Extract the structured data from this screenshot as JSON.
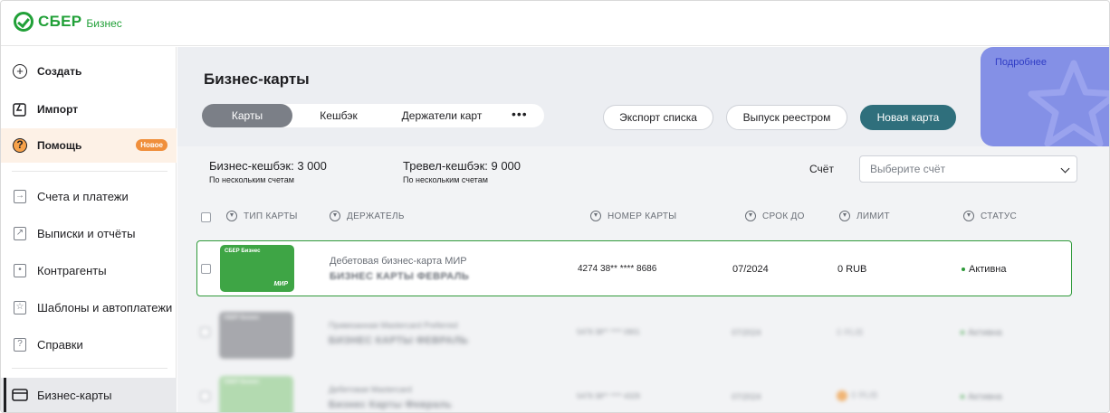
{
  "app": {
    "logo_text": "СБЕР",
    "logo_sub": "Бизнес"
  },
  "sidebar": {
    "create": "Создать",
    "import": "Импорт",
    "help": "Помощь",
    "help_badge": "Новое",
    "items": [
      {
        "label": "Счета и платежи"
      },
      {
        "label": "Выписки и отчёты"
      },
      {
        "label": "Контрагенты"
      },
      {
        "label": "Шаблоны и автоплатежи"
      },
      {
        "label": "Справки"
      }
    ],
    "active": "Бизнес-карты"
  },
  "header": {
    "title": "Бизнес-карты",
    "tabs": [
      "Карты",
      "Кешбэк",
      "Держатели карт"
    ],
    "more": "•••",
    "export_btn": "Экспорт списка",
    "registry_btn": "Выпуск реестром",
    "new_card_btn": "Новая карта",
    "promo_link": "Подробнее"
  },
  "summary": {
    "business_cashback": "Бизнес-кешбэк: 3 000",
    "business_cashback_sub": "По нескольким счетам",
    "travel_cashback": "Тревел-кешбэк: 9 000",
    "travel_cashback_sub": "По нескольким счетам",
    "account_label": "Счёт",
    "account_placeholder": "Выберите счёт"
  },
  "table": {
    "columns": [
      "ТИП КАРТЫ",
      "ДЕРЖАТЕЛЬ",
      "НОМЕР КАРТЫ",
      "СРОК ДО",
      "ЛИМИТ",
      "СТАТУС"
    ],
    "rows": [
      {
        "card_logo": "СБЕР Бизнес",
        "card_brand": "МИР",
        "type": "Дебетовая бизнес-карта МИР",
        "holder": "БИЗНЕС КАРТЫ ФЕВРАЛЬ",
        "number": "4274 38** **** 8686",
        "expiry": "07/2024",
        "limit": "0 RUB",
        "status": "Активна"
      },
      {
        "card_logo": "СБЕР Бизнес",
        "type": "Привязанная Mastercard Preferred",
        "holder": "БИЗНЕС КАРТЫ ФЕВРАЛЬ",
        "number": "5479 38** **** 0901",
        "expiry": "07/2024",
        "limit": "0 RUB",
        "status": "Активна"
      },
      {
        "card_logo": "СБЕР Бизнес",
        "type": "Дебетовая Mastercard",
        "holder": "Бизнес Карты Февраль",
        "number": "5479 38** **** 4329",
        "expiry": "07/2024",
        "limit": "0 RUB",
        "status": "Активна"
      }
    ]
  },
  "colors": {
    "brand_green": "#21a038",
    "primary_button": "#2f6f7c",
    "promo": "#8490e6",
    "badge": "#f08f3c"
  }
}
